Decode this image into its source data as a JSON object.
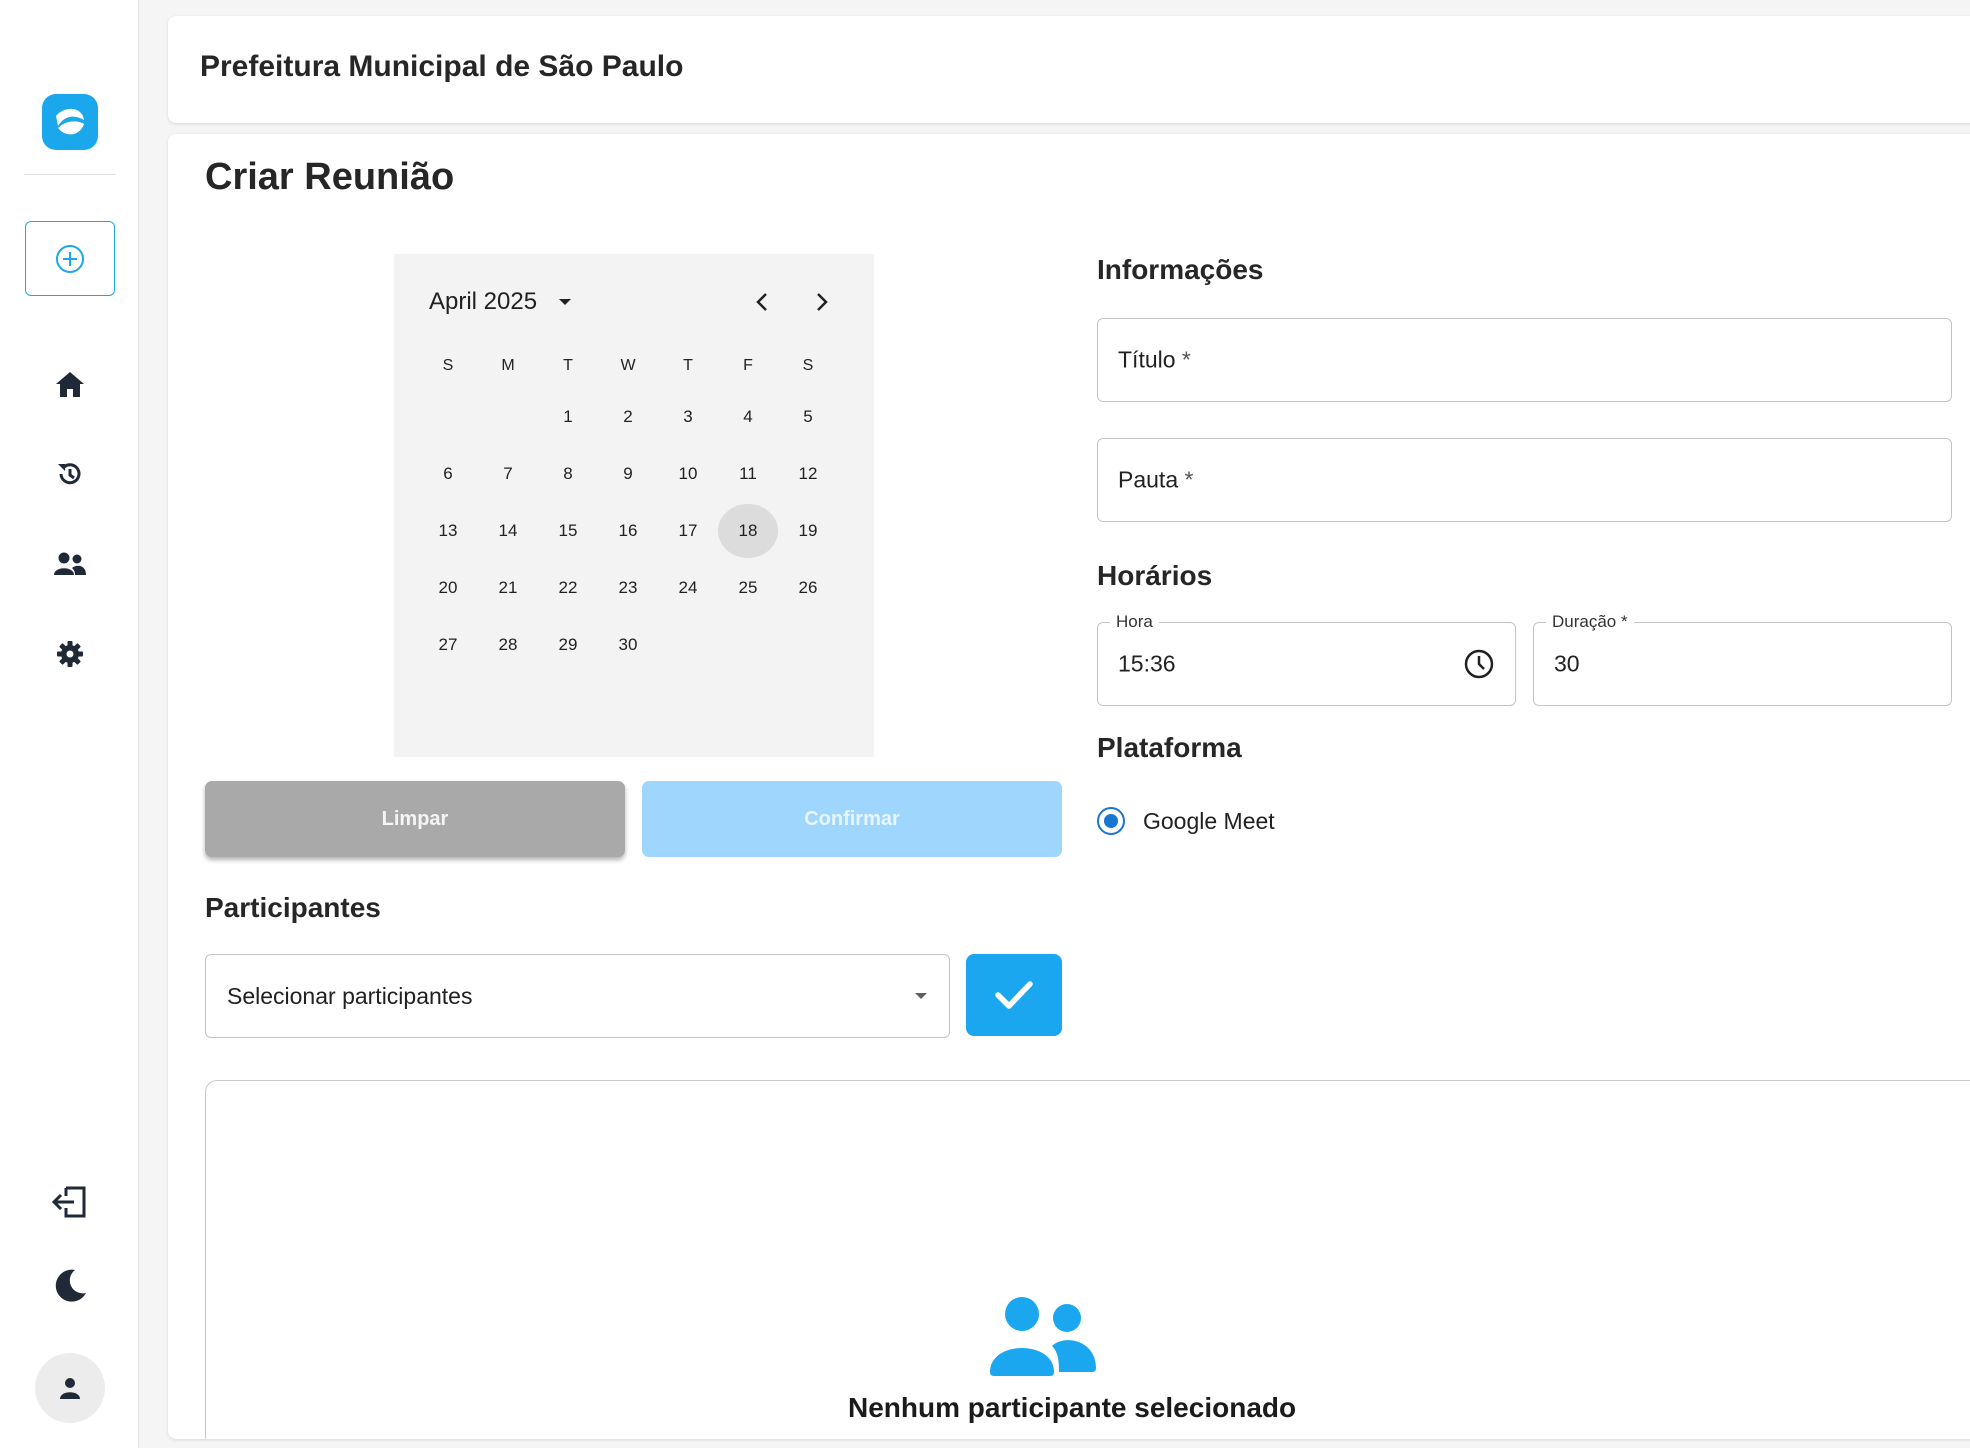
{
  "header": {
    "title": "Prefeitura Municipal de São Paulo"
  },
  "page": {
    "title": "Criar Reunião"
  },
  "sidebar": {
    "items": [
      {
        "icon": "home-icon"
      },
      {
        "icon": "history-icon"
      },
      {
        "icon": "users-icon"
      },
      {
        "icon": "gear-icon"
      },
      {
        "icon": "logout-icon"
      },
      {
        "icon": "moon-icon"
      },
      {
        "icon": "user-icon"
      }
    ],
    "accent": "#1ba7ec"
  },
  "calendar": {
    "month_label": "April 2025",
    "weekdays": [
      "S",
      "M",
      "T",
      "W",
      "T",
      "F",
      "S"
    ],
    "weeks": [
      [
        "",
        "",
        "1",
        "2",
        "3",
        "4",
        "5"
      ],
      [
        "6",
        "7",
        "8",
        "9",
        "10",
        "11",
        "12"
      ],
      [
        "13",
        "14",
        "15",
        "16",
        "17",
        "18",
        "19"
      ],
      [
        "20",
        "21",
        "22",
        "23",
        "24",
        "25",
        "26"
      ],
      [
        "27",
        "28",
        "29",
        "30",
        "",
        "",
        ""
      ]
    ],
    "selected_day": "18"
  },
  "actions": {
    "clear_label": "Limpar",
    "confirm_label": "Confirmar"
  },
  "participants": {
    "section_title": "Participantes",
    "select_placeholder": "Selecionar participantes",
    "empty_message": "Nenhum participante selecionado"
  },
  "info": {
    "section_title": "Informações",
    "title_label": "Título",
    "agenda_label": "Pauta",
    "required_mark": "*"
  },
  "schedule": {
    "section_title": "Horários",
    "time_label": "Hora",
    "time_value": "15:36",
    "duration_label": "Duração",
    "duration_value": "30"
  },
  "platform": {
    "section_title": "Plataforma",
    "option_label": "Google Meet",
    "selected": true
  },
  "colors": {
    "primary": "#1aa7ef",
    "confirm_disabled": "#9fd6fd",
    "clear": "#a9a9a9",
    "radio": "#1976d2"
  }
}
